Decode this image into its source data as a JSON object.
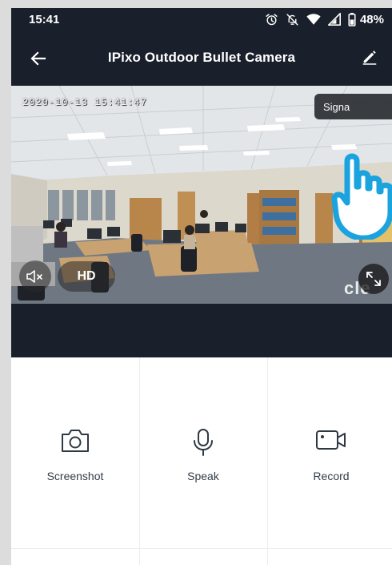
{
  "status_bar": {
    "time": "15:41",
    "battery_percent": "48%",
    "icons": [
      "alarm-icon",
      "notifications-off-icon",
      "wifi-icon",
      "signal-icon",
      "battery-icon"
    ]
  },
  "app_bar": {
    "title": "IPixo Outdoor Bullet Camera",
    "back_icon": "arrow-left-icon",
    "edit_icon": "pencil-icon"
  },
  "video": {
    "timestamp": "2020-10-13 15:41:47",
    "signal_label": "Signa",
    "quality_label": "HD",
    "watermark": "cle",
    "mute_icon": "speaker-muted-icon",
    "fullscreen_icon": "fullscreen-icon"
  },
  "controls": [
    {
      "label": "Screenshot",
      "icon": "camera-icon"
    },
    {
      "label": "Speak",
      "icon": "microphone-icon"
    },
    {
      "label": "Record",
      "icon": "video-camera-icon"
    }
  ],
  "colors": {
    "bar_background": "#1a202b",
    "panel_background": "#ffffff",
    "label_text": "#333c46",
    "cursor_blue": "#1aa3df"
  }
}
